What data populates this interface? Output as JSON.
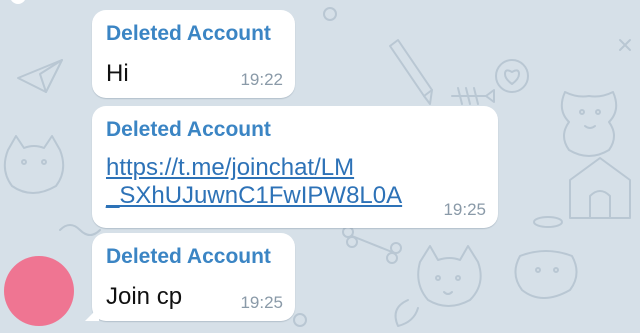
{
  "messages": [
    {
      "sender": "Deleted Account",
      "text": "Hi",
      "time": "19:22"
    },
    {
      "sender": "Deleted Account",
      "link_line1": "https://t.me/joinchat/LM",
      "link_line2": "_SXhUJuwnC1FwIPW8L0A",
      "time": "19:25"
    },
    {
      "sender": "Deleted Account",
      "text": "Join cp",
      "time": "19:25"
    }
  ],
  "colors": {
    "background": "#d6e0e8",
    "bubble": "#ffffff",
    "sender_name": "#3b85c4",
    "link": "#2d72b7",
    "timestamp": "#8a9aa8",
    "avatar": "#ef7592"
  }
}
